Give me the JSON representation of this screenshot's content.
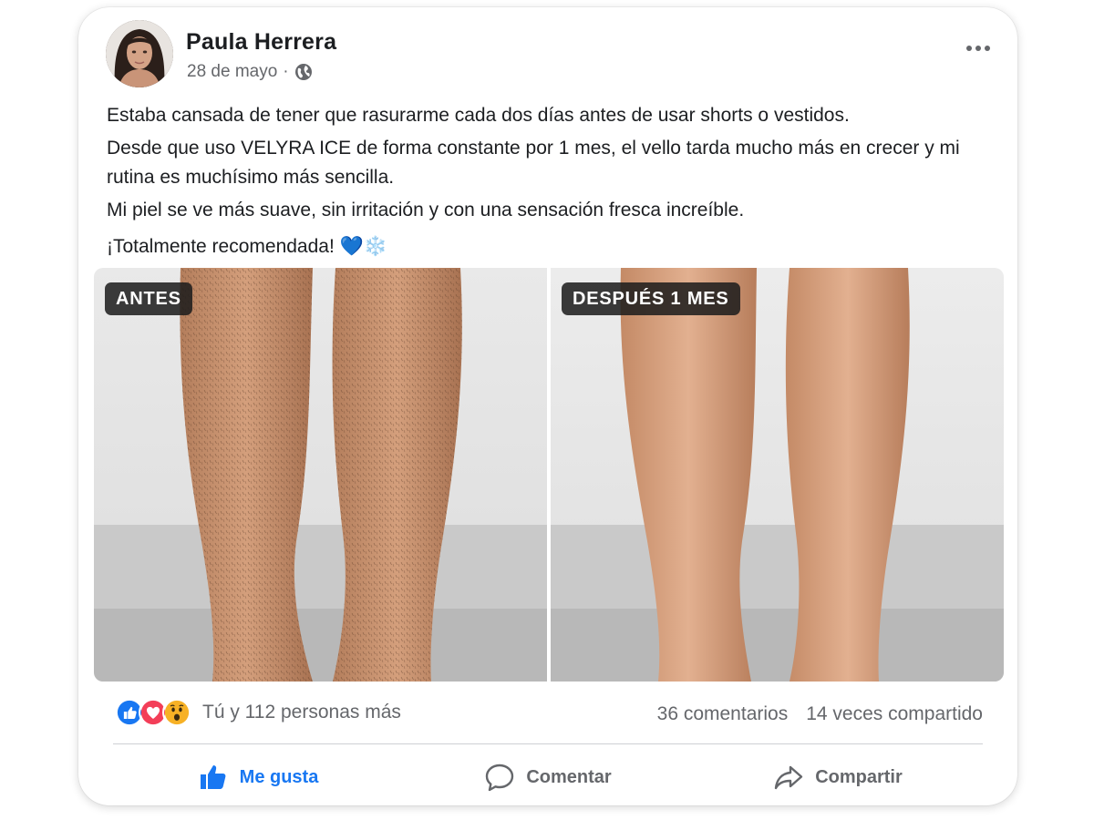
{
  "post": {
    "author": "Paula Herrera",
    "date": "28 de mayo",
    "separator": "·",
    "audience_icon": "globe-icon",
    "menu_icon": "more-horizontal-icon",
    "text": {
      "line1": "Estaba cansada de tener que rasurarme cada dos días antes de usar shorts o vestidos.",
      "line2": "Desde que uso VELYRA ICE de forma constante por 1 mes, el vello tarda mucho más en crecer y mi rutina es muchísimo más sencilla.",
      "line3": "Mi piel se ve más suave, sin irritación y con una sensación fresca increíble.",
      "line4": "¡Totalmente recomendada! 💙❄️"
    }
  },
  "photos": {
    "before_label": "ANTES",
    "after_label": "DESPUÉS 1 MES"
  },
  "engagement": {
    "reaction_icons": [
      "like-reaction-icon",
      "love-reaction-icon",
      "wow-reaction-icon"
    ],
    "reactions_text": "Tú y 112 personas más",
    "comments": "36 comentarios",
    "shares": "14 veces compartido"
  },
  "actions": {
    "like": "Me gusta",
    "comment": "Comentar",
    "share": "Compartir"
  },
  "colors": {
    "accent": "#1877f2",
    "secondary_text": "#65676b",
    "love": "#f33e58",
    "wow": "#f7b125"
  }
}
